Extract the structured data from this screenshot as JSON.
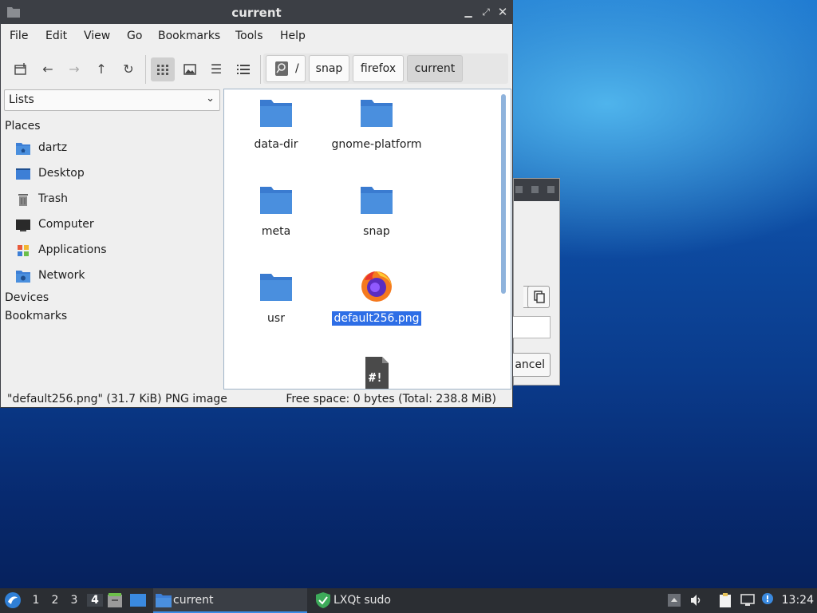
{
  "window": {
    "title": "current",
    "menu": [
      "File",
      "Edit",
      "View",
      "Go",
      "Bookmarks",
      "Tools",
      "Help"
    ],
    "breadcrumbs": [
      "/",
      "snap",
      "firefox",
      "current"
    ],
    "side_select": "Lists",
    "sidebar": {
      "places_label": "Places",
      "items": [
        "dartz",
        "Desktop",
        "Trash",
        "Computer",
        "Applications",
        "Network"
      ],
      "devices_label": "Devices",
      "bookmarks_label": "Bookmarks"
    },
    "files": [
      {
        "name": "data-dir",
        "type": "folder"
      },
      {
        "name": "gnome-platform",
        "type": "folder"
      },
      {
        "name": "meta",
        "type": "folder"
      },
      {
        "name": "snap",
        "type": "folder"
      },
      {
        "name": "usr",
        "type": "folder"
      },
      {
        "name": "default256.png",
        "type": "image",
        "selected": true
      },
      {
        "name": "",
        "type": "script"
      }
    ],
    "status_left": "\"default256.png\" (31.7 KiB) PNG image",
    "status_right": "Free space: 0 bytes (Total: 238.8 MiB)"
  },
  "background_dialog": {
    "button_partial": "ancel",
    "edge_partial": "/"
  },
  "taskbar": {
    "desktops": [
      "1",
      "2",
      "3",
      "4"
    ],
    "active_desktop": "4",
    "tasks": [
      "current",
      "LXQt sudo"
    ],
    "clock": "13:24"
  },
  "colors": {
    "accent": "#2e6ee6",
    "folder": "#4a8fde",
    "titlebar": "#3c3f45",
    "taskbar": "#2b2e33"
  }
}
